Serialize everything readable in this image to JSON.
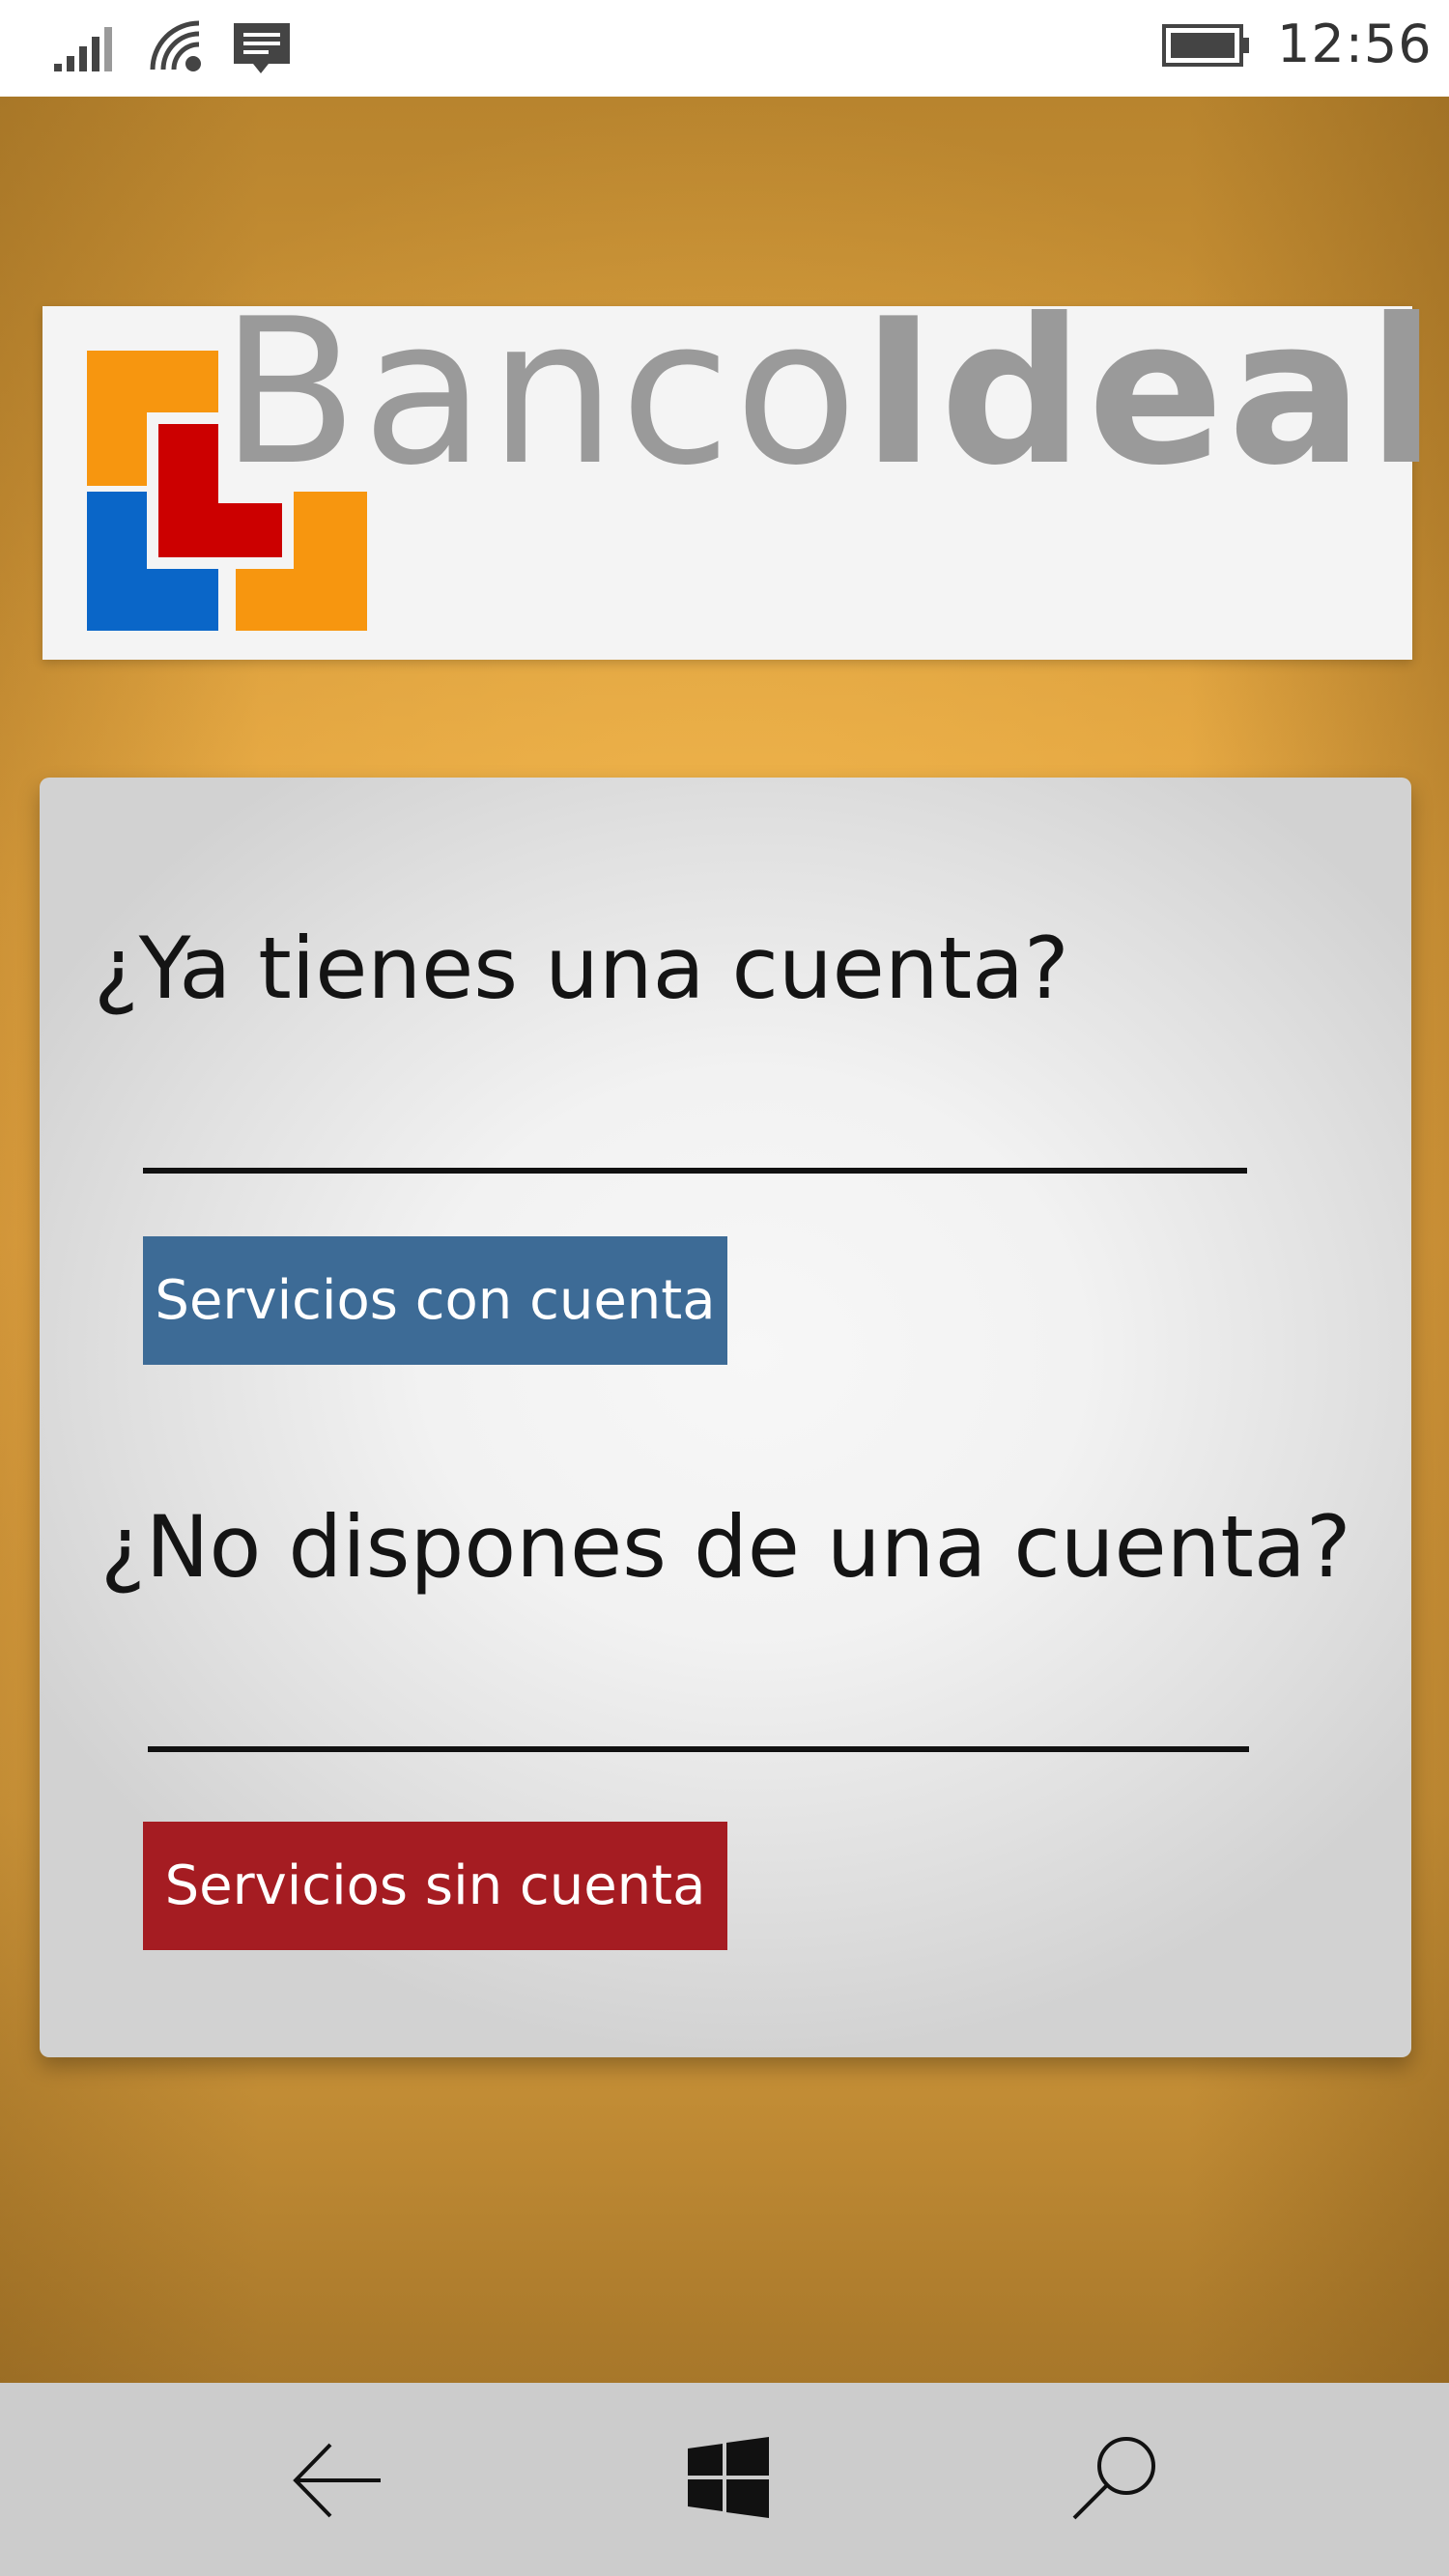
{
  "status_bar": {
    "time": "12:56",
    "icons": [
      "signal-icon",
      "wifi-icon",
      "message-icon",
      "battery-icon"
    ]
  },
  "logo": {
    "text_part1": "Banco",
    "text_part2": "Ideal",
    "colors": {
      "orange": "#f7960f",
      "blue": "#0a66c8",
      "red": "#cc0000",
      "text": "#9a9a9a"
    }
  },
  "card": {
    "question_has_account": "¿Ya tienes una cuenta?",
    "button_with_account": "Servicios con cuenta",
    "question_no_account": "¿No dispones de una cuenta?",
    "button_without_account": "Servicios sin cuenta"
  },
  "colors": {
    "background": "#e7a640",
    "button_with_account": "#3d6b96",
    "button_without_account": "#a51c22",
    "navbar": "#cccccc"
  },
  "navbar": {
    "icons": [
      "back-arrow-icon",
      "windows-icon",
      "search-icon"
    ]
  }
}
